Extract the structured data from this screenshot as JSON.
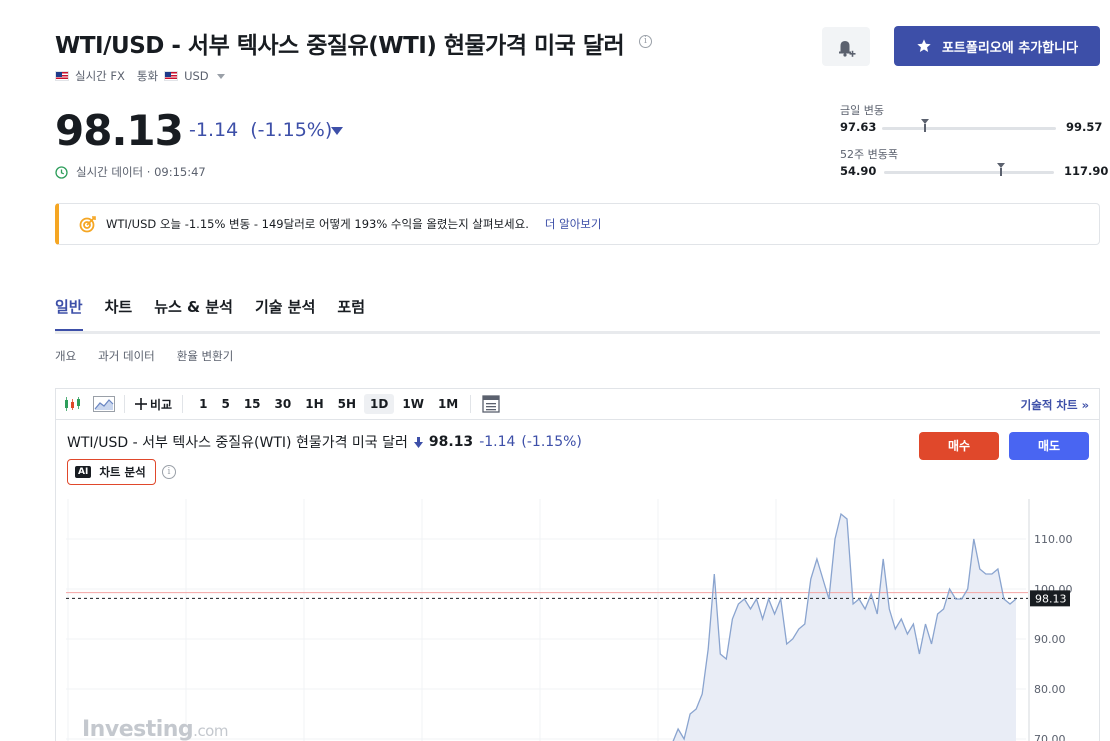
{
  "header": {
    "title": "WTI/USD - 서부 텍사스 중질유(WTI) 현물가격 미국 달러",
    "info_icon": "info-icon",
    "market_label": "실시간 FX",
    "currency_label": "통화",
    "currency_value": "USD",
    "portfolio_button": "포트폴리오에 추가합니다"
  },
  "quote": {
    "price": "98.13",
    "change": "-1.14",
    "change_pct": "(-1.15%)",
    "realtime_label": "실시간 데이터 · 09:15:47"
  },
  "ranges": {
    "day": {
      "label": "금일 변동",
      "low": "97.63",
      "high": "99.57",
      "position": 0.24
    },
    "week52": {
      "label": "52주 변동폭",
      "low": "54.90",
      "high": "117.90",
      "position": 0.68
    }
  },
  "promo": {
    "text": "WTI/USD 오늘 -1.15% 변동 - 149달러로 어떻게 193% 수익을 올렸는지 살펴보세요.",
    "link": "더 알아보기"
  },
  "tabs": [
    {
      "label": "일반",
      "active": true
    },
    {
      "label": "차트",
      "active": false
    },
    {
      "label": "뉴스 & 분석",
      "active": false
    },
    {
      "label": "기술 분석",
      "active": false
    },
    {
      "label": "포럼",
      "active": false
    }
  ],
  "subtabs": [
    "개요",
    "과거 데이터",
    "환율 변환기"
  ],
  "toolbar": {
    "compare": "비교",
    "intervals": [
      "1",
      "5",
      "15",
      "30",
      "1H",
      "5H",
      "1D",
      "1W",
      "1M"
    ],
    "active_interval": "1D",
    "technical_chart": "기술적 차트 »"
  },
  "chart_header": {
    "name": "WTI/USD - 서부 텍사스 중질유(WTI) 현물가격 미국 달러",
    "price": "98.13",
    "change": "-1.14",
    "change_pct": "(-1.15%)",
    "buy": "매수",
    "sell": "매도",
    "ai_badge": "AI",
    "ai_label": "차트 분석"
  },
  "watermark": {
    "brand": "Investing",
    "suffix": ".com"
  },
  "colors": {
    "accent": "#3d4fa8",
    "buy": "#e0482b",
    "sell": "#4965f2",
    "promo_bar": "#f5a623",
    "line": "#8aa4cf",
    "area": "#e9edf6",
    "ref_line": "#f4a4a4"
  },
  "chart_data": {
    "type": "area",
    "ylim": [
      68,
      118
    ],
    "yticks": [
      110,
      100,
      90,
      80,
      70
    ],
    "ytick_labels": [
      "110.00",
      "100.00",
      "90.00",
      "80.00",
      "70.00"
    ],
    "last_value": 98.13,
    "last_label": "98.13",
    "reference_value": 99.27,
    "values": [
      66,
      69,
      72,
      70,
      75,
      76,
      79,
      88,
      103,
      87,
      86,
      94,
      97,
      98,
      96,
      98,
      94,
      98,
      95,
      98,
      89,
      90,
      92,
      93,
      102,
      106,
      102,
      98,
      110,
      115,
      114,
      97,
      98,
      96,
      99,
      95,
      106,
      96,
      92,
      94,
      91,
      93,
      87,
      93,
      89,
      95,
      96,
      100,
      98,
      98,
      100,
      110,
      104,
      103,
      103,
      104,
      98,
      97,
      98
    ]
  }
}
